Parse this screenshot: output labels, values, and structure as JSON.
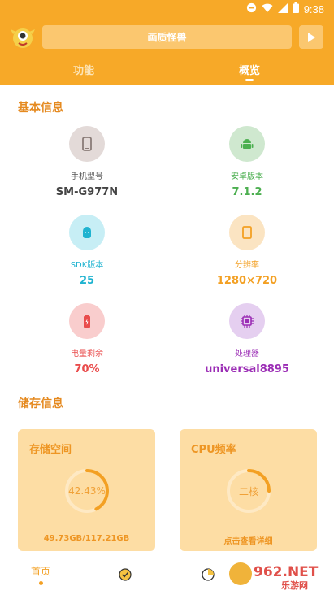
{
  "status": {
    "time": "9:38"
  },
  "header": {
    "title": "画质怪兽"
  },
  "tabs": [
    {
      "label": "功能"
    },
    {
      "label": "概览"
    }
  ],
  "sections": {
    "basic": "基本信息",
    "storage": "储存信息"
  },
  "info": [
    {
      "label": "手机型号",
      "value": "SM-G977N",
      "color": "#444444",
      "bg": "#E3DAD8",
      "icon": "phone-icon"
    },
    {
      "label": "安卓版本",
      "value": "7.1.2",
      "color": "#4CAF50",
      "bg": "#CFE8CF",
      "icon": "android-icon"
    },
    {
      "label": "SDK版本",
      "value": "25",
      "color": "#1FB3D0",
      "bg": "#C7EEF5",
      "icon": "sdk-icon"
    },
    {
      "label": "分辨率",
      "value": "1280×720",
      "color": "#F3A023",
      "bg": "#FBE4C2",
      "icon": "resolution-icon"
    },
    {
      "label": "电量剩余",
      "value": "70%",
      "color": "#E94C4C",
      "bg": "#F9CDCD",
      "icon": "battery-icon"
    },
    {
      "label": "处理器",
      "value": "universal8895",
      "color": "#9B2DB5",
      "bg": "#E5CFF0",
      "icon": "chip-icon"
    }
  ],
  "cards": [
    {
      "title": "存储空间",
      "center": "42.43%",
      "footer": "49.73GB/117.21GB",
      "progress": 0.4243
    },
    {
      "title": "CPU频率",
      "center": "二核",
      "footer": "点击查看详细",
      "progress": 0.25
    }
  ],
  "nav": {
    "home": "首页"
  },
  "watermark": {
    "brand": "962.NET",
    "sub": "乐游网"
  }
}
